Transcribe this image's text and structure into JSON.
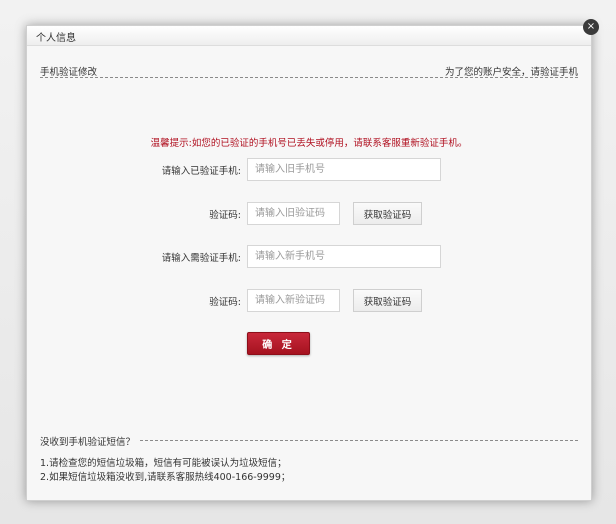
{
  "dialog": {
    "title": "个人信息",
    "close_glyph": "×"
  },
  "section": {
    "title": "手机验证修改",
    "note": "为了您的账户安全，请验证手机"
  },
  "tip": "温馨提示:如您的已验证的手机号已丢失或停用，请联系客服重新验证手机。",
  "form": {
    "old_phone_label": "请输入已验证手机:",
    "old_phone_placeholder": "请输入旧手机号",
    "old_code_label": "验证码:",
    "old_code_placeholder": "请输入旧验证码",
    "old_code_button": "获取验证码",
    "new_phone_label": "请输入需验证手机:",
    "new_phone_placeholder": "请输入新手机号",
    "new_code_label": "验证码:",
    "new_code_placeholder": "请输入新验证码",
    "new_code_button": "获取验证码",
    "confirm_button": "确 定"
  },
  "help": {
    "title": "没收到手机验证短信？",
    "line1": "1.请检查您的短信垃圾箱，短信有可能被误认为垃圾短信；",
    "line2": "2.如果短信垃圾箱没收到,请联系客服热线400-166-9999；"
  },
  "colors": {
    "accent_red": "#a5121f",
    "tip_red": "#b01020"
  }
}
